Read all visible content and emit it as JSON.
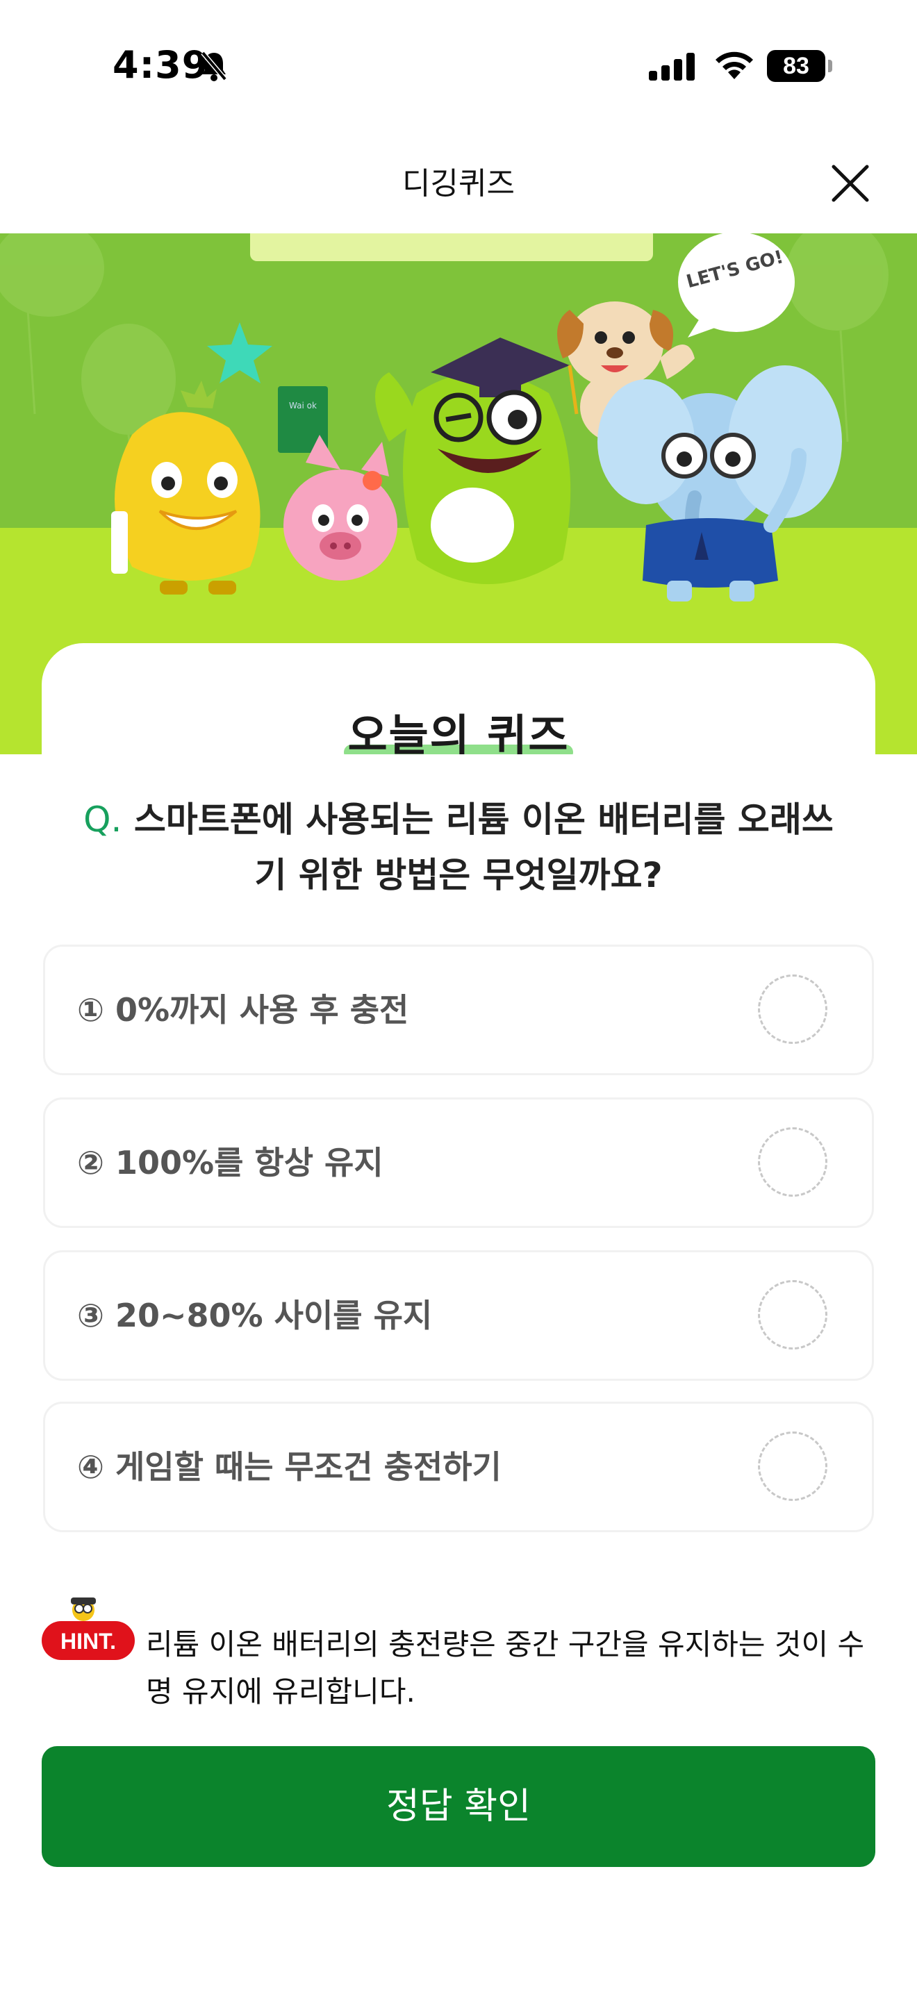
{
  "status_bar": {
    "time": "4:39",
    "battery_percent": "83",
    "battery_level": 0.83,
    "icons": [
      "bell-slash-icon",
      "cellular-signal-icon",
      "wifi-icon",
      "battery-icon"
    ]
  },
  "header": {
    "title": "디깅퀴즈",
    "close_icon": "close-icon"
  },
  "banner": {
    "speech_bubble_text": "LET'S GO!",
    "book_text": "Wai ok",
    "colors": {
      "top": "#7fc33a",
      "bottom": "#b5e42f"
    }
  },
  "quiz": {
    "heading": "오늘의 퀴즈",
    "question_prefix": "Q.",
    "question": "스마트폰에 사용되는 리튬 이온 배터리를 오래쓰기 위한 방법은 무엇일까요?",
    "options": [
      {
        "label": "① 0%까지 사용 후 충전"
      },
      {
        "label": "② 100%를 항상 유지"
      },
      {
        "label": "③ 20~80% 사이를 유지"
      },
      {
        "label": "④ 게임할 때는 무조건 충전하기"
      }
    ]
  },
  "hint": {
    "badge": "HINT.",
    "text": "리튬 이온 배터리의 충전량은 중간 구간을 유지하는 것이 수명 유지에 유리합니다."
  },
  "submit": {
    "label": "정답 확인"
  },
  "colors": {
    "accent_green": "#0b842c",
    "question_prefix": "#17a05d",
    "hint_red": "#e0121b"
  }
}
